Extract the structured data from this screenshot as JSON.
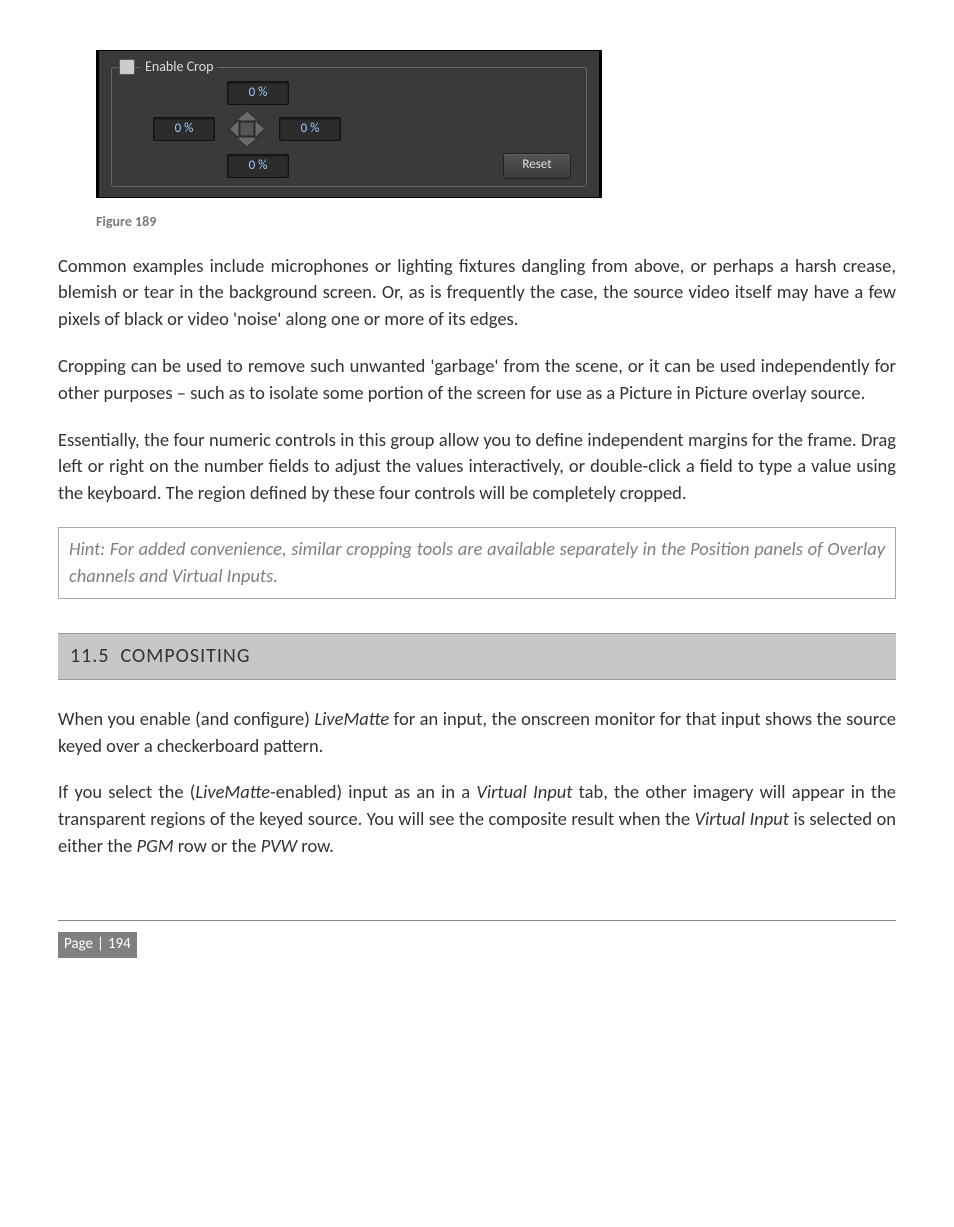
{
  "crop_panel": {
    "legend": "Enable Crop",
    "top": "0 %",
    "left": "0 %",
    "right": "0 %",
    "bottom": "0 %",
    "reset": "Reset"
  },
  "figure_caption": "Figure 189",
  "para1": "Common examples include microphones or lighting fixtures dangling from above, or perhaps a harsh crease, blemish or tear in the background screen.  Or, as is frequently the case, the source video itself may have a few pixels of black or video 'noise' along one or more of its edges.",
  "para2": "Cropping can be used to remove such unwanted 'garbage' from the scene, or it can be used independently for other purposes – such as to isolate some portion of the screen for use as a Picture in Picture overlay source.",
  "para3": "Essentially, the four numeric controls in this group allow you to define independent margins for the frame.  Drag left or right on the number fields to adjust the values interactively, or double-click a field to type a value using the keyboard.  The region defined by these four controls will be completely cropped.",
  "hint": "Hint: For added convenience, similar cropping tools are available separately in the Position panels of Overlay channels and Virtual Inputs.",
  "section_number": "11.5",
  "section_title": "COMPOSITING",
  "para4_a": "When you enable (and configure) ",
  "para4_i1": "LiveMatte",
  "para4_b": " for an input, the onscreen monitor for that input shows the source keyed over a checkerboard pattern.",
  "para5_a": "If you select the (",
  "para5_i1": "LiveMatte",
  "para5_b": "-enabled) input as an in a ",
  "para5_i2": "Virtual Input",
  "para5_c": " tab, the other imagery will appear in the transparent regions of the keyed source.  You will see the composite result when the ",
  "para5_i3": "Virtual Input",
  "para5_d": " is selected on either the ",
  "para5_i4": "PGM",
  "para5_e": " row or the ",
  "para5_i5": "PVW",
  "para5_f": " row.",
  "footer_label": "Page",
  "footer_num": "194"
}
